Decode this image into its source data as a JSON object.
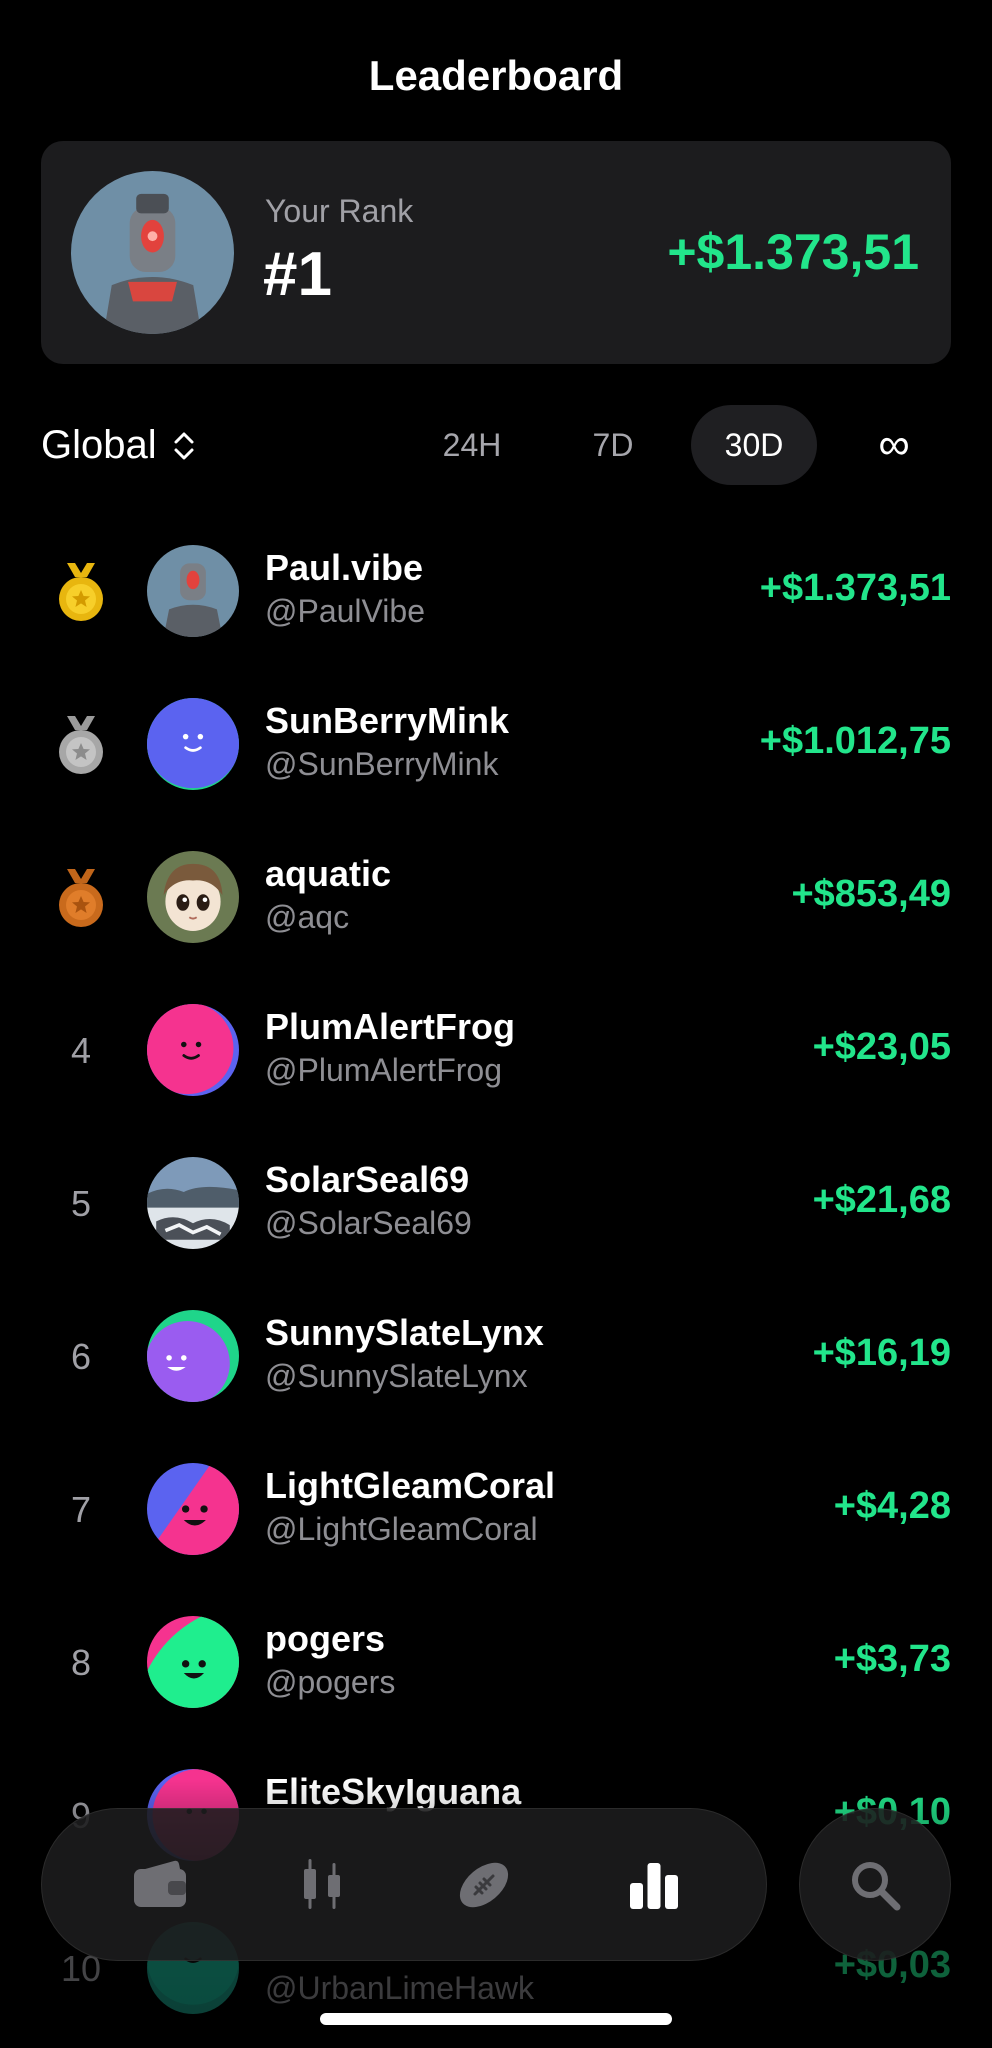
{
  "header": {
    "title": "Leaderboard"
  },
  "your_rank": {
    "label": "Your Rank",
    "rank": "#1",
    "amount": "+$1.373,51"
  },
  "filters": {
    "scope": "Global",
    "periods": [
      "24H",
      "7D",
      "30D",
      "∞"
    ],
    "active_period": "30D"
  },
  "leaderboard": [
    {
      "rank": "1",
      "medal": "gold-medal",
      "name": "Paul.vibe",
      "handle": "@PaulVibe",
      "amount": "+$1.373,51"
    },
    {
      "rank": "2",
      "medal": "silver-medal",
      "name": "SunBerryMink",
      "handle": "@SunBerryMink",
      "amount": "+$1.012,75"
    },
    {
      "rank": "3",
      "medal": "bronze-medal",
      "name": "aquatic",
      "handle": "@aqc",
      "amount": "+$853,49"
    },
    {
      "rank": "4",
      "name": "PlumAlertFrog",
      "handle": "@PlumAlertFrog",
      "amount": "+$23,05"
    },
    {
      "rank": "5",
      "name": "SolarSeal69",
      "handle": "@SolarSeal69",
      "amount": "+$21,68"
    },
    {
      "rank": "6",
      "name": "SunnySlateLynx",
      "handle": "@SunnySlateLynx",
      "amount": "+$16,19"
    },
    {
      "rank": "7",
      "name": "LightGleamCoral",
      "handle": "@LightGleamCoral",
      "amount": "+$4,28"
    },
    {
      "rank": "8",
      "name": "pogers",
      "handle": "@pogers",
      "amount": "+$3,73"
    },
    {
      "rank": "9",
      "name": "EliteSkyIguana",
      "handle": "",
      "amount": "+$0,10"
    },
    {
      "rank": "10",
      "name": "",
      "handle": "@UrbanLimeHawk",
      "amount": "+$0,03"
    }
  ],
  "tabbar": {
    "items": [
      "wallet-icon",
      "candlestick-chart-icon",
      "football-icon",
      "leaderboard-icon"
    ],
    "active": "leaderboard-icon",
    "search": "search-icon"
  },
  "colors": {
    "positive": "#22e58b",
    "background": "#000000",
    "card": "#1c1c1e"
  }
}
